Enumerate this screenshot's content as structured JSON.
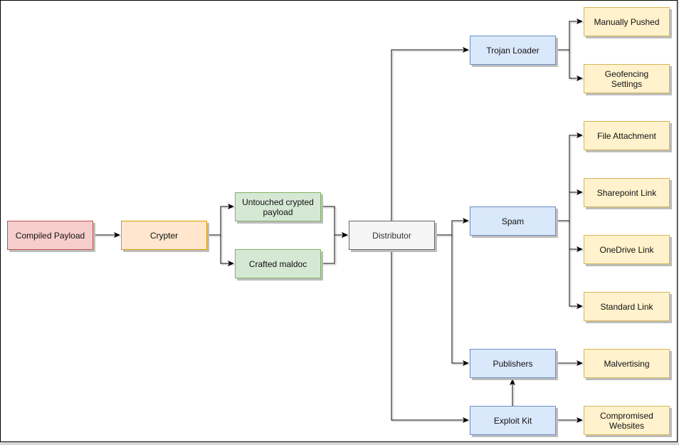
{
  "diagram": {
    "nodes": {
      "compiled_payload": "Compiled Payload",
      "crypter": "Crypter",
      "untouched_crypted_payload": "Untouched crypted payload",
      "crafted_maldoc": "Crafted maldoc",
      "distributor": "Distributor",
      "trojan_loader": "Trojan Loader",
      "spam": "Spam",
      "publishers": "Publishers",
      "exploit_kit": "Exploit Kit",
      "manually_pushed": "Manually Pushed",
      "geofencing_settings": "Geofencing Settings",
      "file_attachment": "File Attachment",
      "sharepoint_link": "Sharepoint Link",
      "onedrive_link": "OneDrive Link",
      "standard_link": "Standard Link",
      "malvertising": "Malvertising",
      "compromised_websites": "Compromised Websites"
    },
    "edges": [
      [
        "compiled_payload",
        "crypter"
      ],
      [
        "crypter",
        "untouched_crypted_payload"
      ],
      [
        "crypter",
        "crafted_maldoc"
      ],
      [
        "untouched_crypted_payload",
        "distributor"
      ],
      [
        "crafted_maldoc",
        "distributor"
      ],
      [
        "distributor",
        "trojan_loader"
      ],
      [
        "distributor",
        "spam"
      ],
      [
        "distributor",
        "publishers"
      ],
      [
        "distributor",
        "exploit_kit"
      ],
      [
        "trojan_loader",
        "manually_pushed"
      ],
      [
        "trojan_loader",
        "geofencing_settings"
      ],
      [
        "spam",
        "file_attachment"
      ],
      [
        "spam",
        "sharepoint_link"
      ],
      [
        "spam",
        "onedrive_link"
      ],
      [
        "spam",
        "standard_link"
      ],
      [
        "publishers",
        "malvertising"
      ],
      [
        "exploit_kit",
        "publishers"
      ],
      [
        "exploit_kit",
        "compromised_websites"
      ]
    ],
    "colors": {
      "source": "#f8cecc",
      "crypter": "#ffe6cc",
      "payload_variants": "#d5e8d4",
      "distributor": "#f5f5f5",
      "channels": "#dae8fc",
      "methods": "#fff2cc"
    }
  }
}
